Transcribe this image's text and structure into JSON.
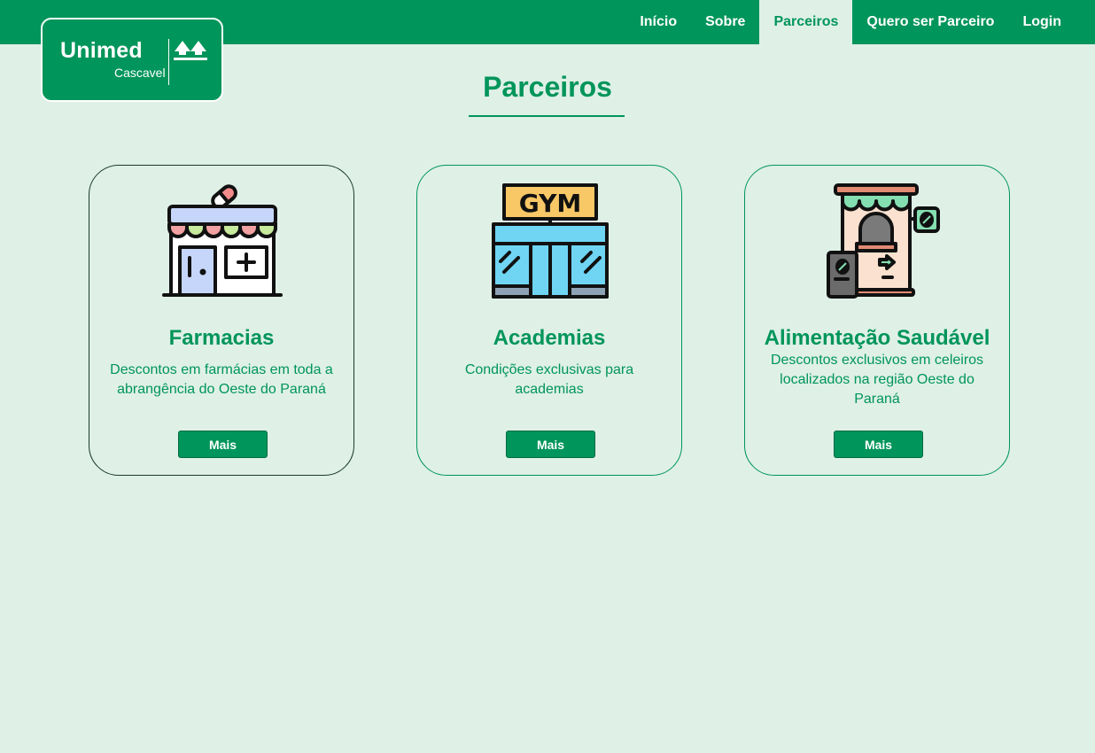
{
  "logo": {
    "name": "Unimed",
    "city": "Cascavel"
  },
  "nav": {
    "items": [
      {
        "label": "Início"
      },
      {
        "label": "Sobre"
      },
      {
        "label": "Parceiros"
      },
      {
        "label": "Quero ser Parceiro"
      },
      {
        "label": "Login"
      }
    ],
    "active": "Parceiros"
  },
  "page": {
    "title": "Parceiros"
  },
  "cards": [
    {
      "icon": "pharmacy-store-icon",
      "title": "Farmacias",
      "description": "Descontos em farmácias em toda a abrangência do Oeste do Paraná",
      "button": "Mais"
    },
    {
      "icon": "gym-building-icon",
      "title": "Academias",
      "description": "Condições exclusivas para academias",
      "button": "Mais"
    },
    {
      "icon": "coffee-shop-icon",
      "title": "Alimentação Saudável",
      "description": "Descontos exclusivos em celeiros localizados na região Oeste do Paraná",
      "button": "Mais"
    }
  ],
  "colors": {
    "brand_green": "#00955a",
    "background": "#dff0e7",
    "text_light": "#ffffff"
  }
}
